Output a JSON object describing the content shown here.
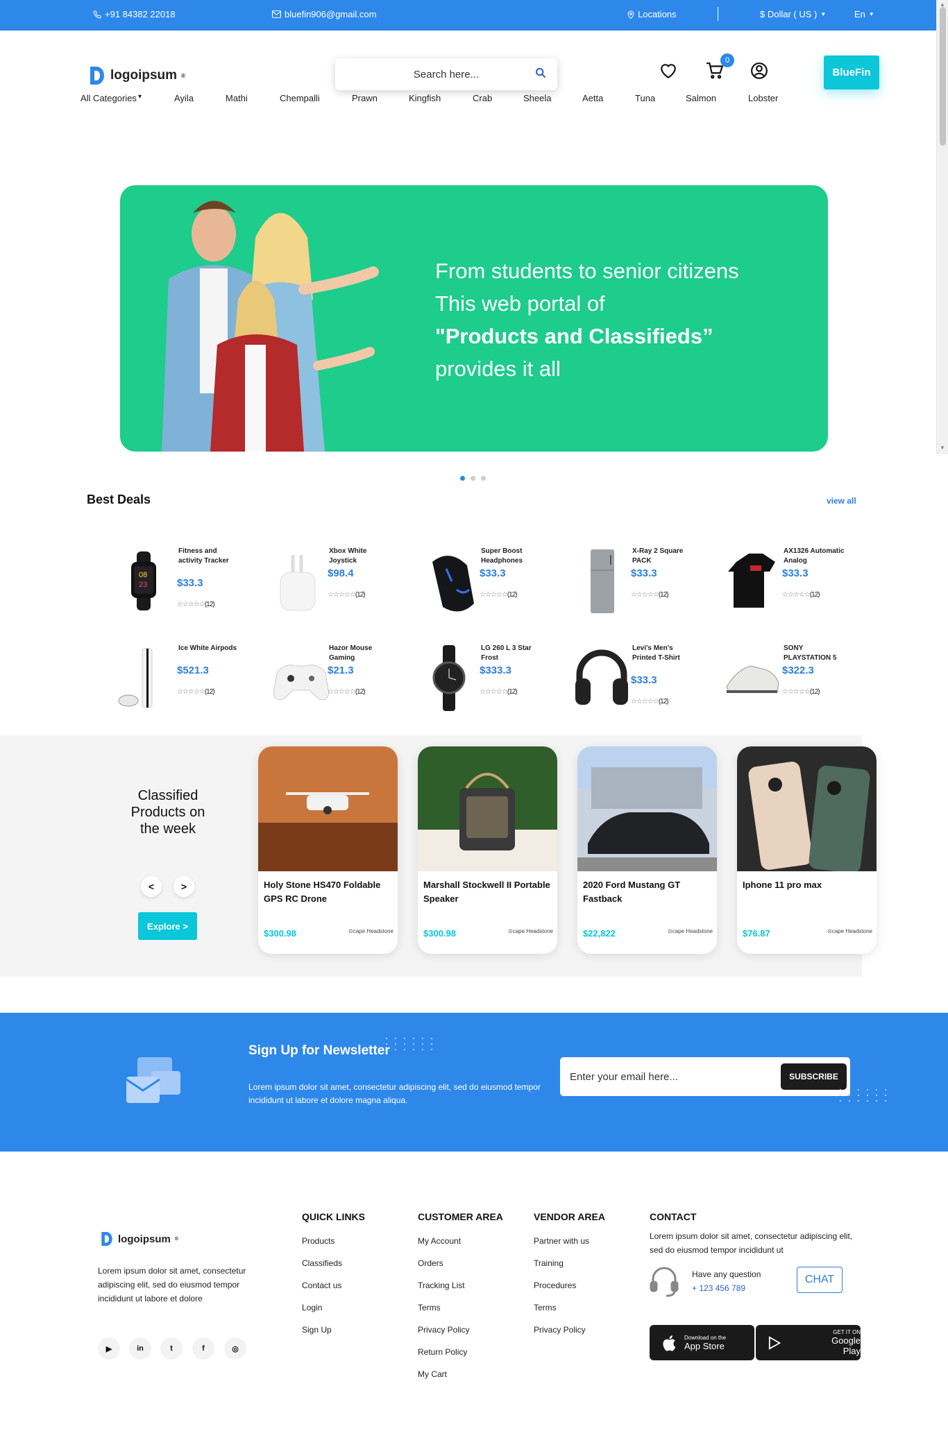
{
  "topbar": {
    "phone": "+91 84382 22018",
    "email": "bluefin906@gmail.com",
    "locations": "Locations",
    "currency": "$ Dollar ( US )",
    "lang": "En"
  },
  "header": {
    "logo_text": "logoipsum",
    "search_placeholder": "Search here...",
    "cart_count": "0",
    "brand_button": "BlueFin"
  },
  "categories": [
    "All Categories",
    "Ayila",
    "Mathi",
    "Chempalli",
    "Prawn",
    "Kingfish",
    "Crab",
    "Sheela",
    "Aetta",
    "Tuna",
    "Salmon",
    "Lobster"
  ],
  "hero": {
    "line1": "From students to senior citizens",
    "line2": "This web portal of",
    "line3": "\"Products and Classifieds”",
    "line4": "provides it all"
  },
  "best_deals": {
    "title": "Best Deals",
    "view_all": "view all",
    "items": [
      {
        "name": "Fitness and activity Tracker",
        "price": "$33.3",
        "rating_count": "(12)",
        "icon": "watch-icon"
      },
      {
        "name": "Xbox White Joystick",
        "price": "$98.4",
        "rating_count": "(12)",
        "icon": "airpods-icon"
      },
      {
        "name": "Super Boost Headphones",
        "price": "$33.3",
        "rating_count": "(12)",
        "icon": "mouse-icon"
      },
      {
        "name": "X-Ray 2 Square PACK",
        "price": "$33.3",
        "rating_count": "(12)",
        "icon": "fridge-icon"
      },
      {
        "name": "AX1326 Automatic Analog",
        "price": "$33.3",
        "rating_count": "(12)",
        "icon": "tshirt-icon"
      },
      {
        "name": "Ice White Airpods",
        "price": "$521.3",
        "rating_count": "(12)",
        "icon": "console-icon"
      },
      {
        "name": "Hazor Mouse Gaming",
        "price": "$21.3",
        "rating_count": "(12)",
        "icon": "gamepad-icon"
      },
      {
        "name": "LG 260 L 3 Star Frost",
        "price": "$333.3",
        "rating_count": "(12)",
        "icon": "wristwatch-icon"
      },
      {
        "name": "Levi's Men's Printed T-Shirt",
        "price": "$33.3",
        "rating_count": "(12)",
        "icon": "headphones-icon"
      },
      {
        "name": "SONY PLAYSTATION 5",
        "price": "$322.3",
        "rating_count": "(12)",
        "icon": "sneakers-icon"
      }
    ]
  },
  "classified": {
    "title": "Classified Products on the week",
    "prev": "<",
    "next": ">",
    "explore": "Explore >",
    "items": [
      {
        "title": "Holy Stone HS470 Foldable GPS RC Drone",
        "price": "$300.98",
        "location": "cape Headstone"
      },
      {
        "title": "Marshall Stockwell II Portable Speaker",
        "price": "$300.98",
        "location": "cape Headstone"
      },
      {
        "title": "2020 Ford Mustang GT Fastback",
        "price": "$22,822",
        "location": "cape Headstone"
      },
      {
        "title": "Iphone 11 pro max",
        "price": "$76.87",
        "location": "cape Headstone"
      }
    ]
  },
  "newsletter": {
    "title": "Sign Up for Newsletter",
    "desc": "Lorem ipsum dolor sit amet, consectetur adipiscing elit, sed do eiusmod tempor incididunt ut labore et dolore magna aliqua.",
    "placeholder": "Enter your email here...",
    "button": "SUBSCRIBE"
  },
  "footer": {
    "logo_text": "logoipsum",
    "about": "Lorem ipsum dolor sit amet, consectetur adipiscing elit, sed do eiusmod tempor incididunt ut labore et dolore",
    "quick_links": {
      "title": "QUICK LINKS",
      "links": [
        "Products",
        "Classifieds",
        "Contact us",
        "Login",
        "Sign Up"
      ]
    },
    "customer_area": {
      "title": "CUSTOMER AREA",
      "links": [
        "My Account",
        "Orders",
        "Tracking List",
        "Terms",
        "Privacy Policy",
        "Return Policy",
        "My Cart"
      ]
    },
    "vendor_area": {
      "title": "VENDOR AREA",
      "links": [
        "Partner with us",
        "Training",
        "Procedures",
        "Terms",
        "Privacy Policy"
      ]
    },
    "contact": {
      "title": "CONTACT",
      "desc": "Lorem ipsum dolor sit amet, consectetur adipiscing elit, sed do eiusmod tempor incididunt ut",
      "question": "Have any question",
      "phone": "+ 123 456 789",
      "chat": "CHAT"
    },
    "app_store": {
      "small": "Download on the",
      "big": "App Store"
    },
    "google_play": {
      "small": "GET IT ON",
      "big": "Google Play"
    }
  }
}
